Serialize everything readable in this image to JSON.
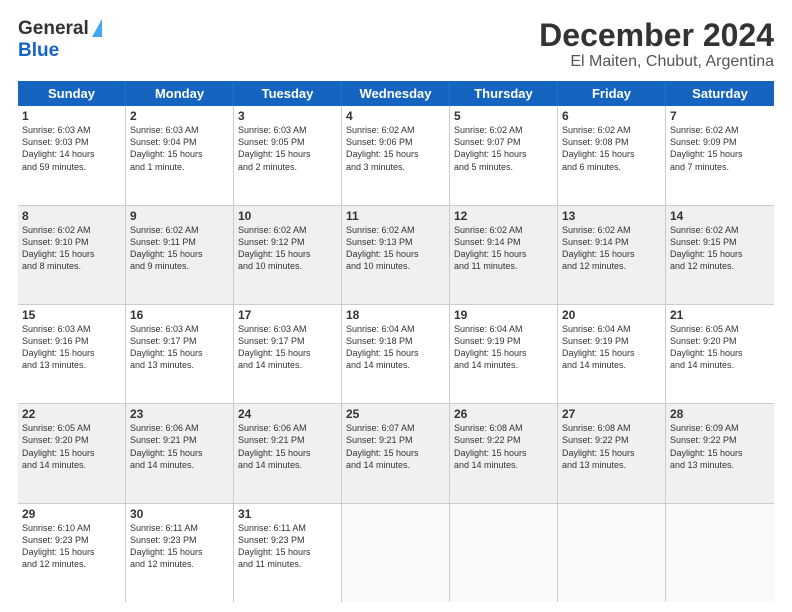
{
  "header": {
    "logo_general": "General",
    "logo_blue": "Blue",
    "month_title": "December 2024",
    "location": "El Maiten, Chubut, Argentina"
  },
  "calendar": {
    "weekdays": [
      "Sunday",
      "Monday",
      "Tuesday",
      "Wednesday",
      "Thursday",
      "Friday",
      "Saturday"
    ],
    "rows": [
      [
        {
          "day": "1",
          "lines": [
            "Sunrise: 6:03 AM",
            "Sunset: 9:03 PM",
            "Daylight: 14 hours",
            "and 59 minutes."
          ]
        },
        {
          "day": "2",
          "lines": [
            "Sunrise: 6:03 AM",
            "Sunset: 9:04 PM",
            "Daylight: 15 hours",
            "and 1 minute."
          ]
        },
        {
          "day": "3",
          "lines": [
            "Sunrise: 6:03 AM",
            "Sunset: 9:05 PM",
            "Daylight: 15 hours",
            "and 2 minutes."
          ]
        },
        {
          "day": "4",
          "lines": [
            "Sunrise: 6:02 AM",
            "Sunset: 9:06 PM",
            "Daylight: 15 hours",
            "and 3 minutes."
          ]
        },
        {
          "day": "5",
          "lines": [
            "Sunrise: 6:02 AM",
            "Sunset: 9:07 PM",
            "Daylight: 15 hours",
            "and 5 minutes."
          ]
        },
        {
          "day": "6",
          "lines": [
            "Sunrise: 6:02 AM",
            "Sunset: 9:08 PM",
            "Daylight: 15 hours",
            "and 6 minutes."
          ]
        },
        {
          "day": "7",
          "lines": [
            "Sunrise: 6:02 AM",
            "Sunset: 9:09 PM",
            "Daylight: 15 hours",
            "and 7 minutes."
          ]
        }
      ],
      [
        {
          "day": "8",
          "lines": [
            "Sunrise: 6:02 AM",
            "Sunset: 9:10 PM",
            "Daylight: 15 hours",
            "and 8 minutes."
          ]
        },
        {
          "day": "9",
          "lines": [
            "Sunrise: 6:02 AM",
            "Sunset: 9:11 PM",
            "Daylight: 15 hours",
            "and 9 minutes."
          ]
        },
        {
          "day": "10",
          "lines": [
            "Sunrise: 6:02 AM",
            "Sunset: 9:12 PM",
            "Daylight: 15 hours",
            "and 10 minutes."
          ]
        },
        {
          "day": "11",
          "lines": [
            "Sunrise: 6:02 AM",
            "Sunset: 9:13 PM",
            "Daylight: 15 hours",
            "and 10 minutes."
          ]
        },
        {
          "day": "12",
          "lines": [
            "Sunrise: 6:02 AM",
            "Sunset: 9:14 PM",
            "Daylight: 15 hours",
            "and 11 minutes."
          ]
        },
        {
          "day": "13",
          "lines": [
            "Sunrise: 6:02 AM",
            "Sunset: 9:14 PM",
            "Daylight: 15 hours",
            "and 12 minutes."
          ]
        },
        {
          "day": "14",
          "lines": [
            "Sunrise: 6:02 AM",
            "Sunset: 9:15 PM",
            "Daylight: 15 hours",
            "and 12 minutes."
          ]
        }
      ],
      [
        {
          "day": "15",
          "lines": [
            "Sunrise: 6:03 AM",
            "Sunset: 9:16 PM",
            "Daylight: 15 hours",
            "and 13 minutes."
          ]
        },
        {
          "day": "16",
          "lines": [
            "Sunrise: 6:03 AM",
            "Sunset: 9:17 PM",
            "Daylight: 15 hours",
            "and 13 minutes."
          ]
        },
        {
          "day": "17",
          "lines": [
            "Sunrise: 6:03 AM",
            "Sunset: 9:17 PM",
            "Daylight: 15 hours",
            "and 14 minutes."
          ]
        },
        {
          "day": "18",
          "lines": [
            "Sunrise: 6:04 AM",
            "Sunset: 9:18 PM",
            "Daylight: 15 hours",
            "and 14 minutes."
          ]
        },
        {
          "day": "19",
          "lines": [
            "Sunrise: 6:04 AM",
            "Sunset: 9:19 PM",
            "Daylight: 15 hours",
            "and 14 minutes."
          ]
        },
        {
          "day": "20",
          "lines": [
            "Sunrise: 6:04 AM",
            "Sunset: 9:19 PM",
            "Daylight: 15 hours",
            "and 14 minutes."
          ]
        },
        {
          "day": "21",
          "lines": [
            "Sunrise: 6:05 AM",
            "Sunset: 9:20 PM",
            "Daylight: 15 hours",
            "and 14 minutes."
          ]
        }
      ],
      [
        {
          "day": "22",
          "lines": [
            "Sunrise: 6:05 AM",
            "Sunset: 9:20 PM",
            "Daylight: 15 hours",
            "and 14 minutes."
          ]
        },
        {
          "day": "23",
          "lines": [
            "Sunrise: 6:06 AM",
            "Sunset: 9:21 PM",
            "Daylight: 15 hours",
            "and 14 minutes."
          ]
        },
        {
          "day": "24",
          "lines": [
            "Sunrise: 6:06 AM",
            "Sunset: 9:21 PM",
            "Daylight: 15 hours",
            "and 14 minutes."
          ]
        },
        {
          "day": "25",
          "lines": [
            "Sunrise: 6:07 AM",
            "Sunset: 9:21 PM",
            "Daylight: 15 hours",
            "and 14 minutes."
          ]
        },
        {
          "day": "26",
          "lines": [
            "Sunrise: 6:08 AM",
            "Sunset: 9:22 PM",
            "Daylight: 15 hours",
            "and 14 minutes."
          ]
        },
        {
          "day": "27",
          "lines": [
            "Sunrise: 6:08 AM",
            "Sunset: 9:22 PM",
            "Daylight: 15 hours",
            "and 13 minutes."
          ]
        },
        {
          "day": "28",
          "lines": [
            "Sunrise: 6:09 AM",
            "Sunset: 9:22 PM",
            "Daylight: 15 hours",
            "and 13 minutes."
          ]
        }
      ],
      [
        {
          "day": "29",
          "lines": [
            "Sunrise: 6:10 AM",
            "Sunset: 9:23 PM",
            "Daylight: 15 hours",
            "and 12 minutes."
          ]
        },
        {
          "day": "30",
          "lines": [
            "Sunrise: 6:11 AM",
            "Sunset: 9:23 PM",
            "Daylight: 15 hours",
            "and 12 minutes."
          ]
        },
        {
          "day": "31",
          "lines": [
            "Sunrise: 6:11 AM",
            "Sunset: 9:23 PM",
            "Daylight: 15 hours",
            "and 11 minutes."
          ]
        },
        {
          "day": "",
          "lines": []
        },
        {
          "day": "",
          "lines": []
        },
        {
          "day": "",
          "lines": []
        },
        {
          "day": "",
          "lines": []
        }
      ]
    ]
  }
}
